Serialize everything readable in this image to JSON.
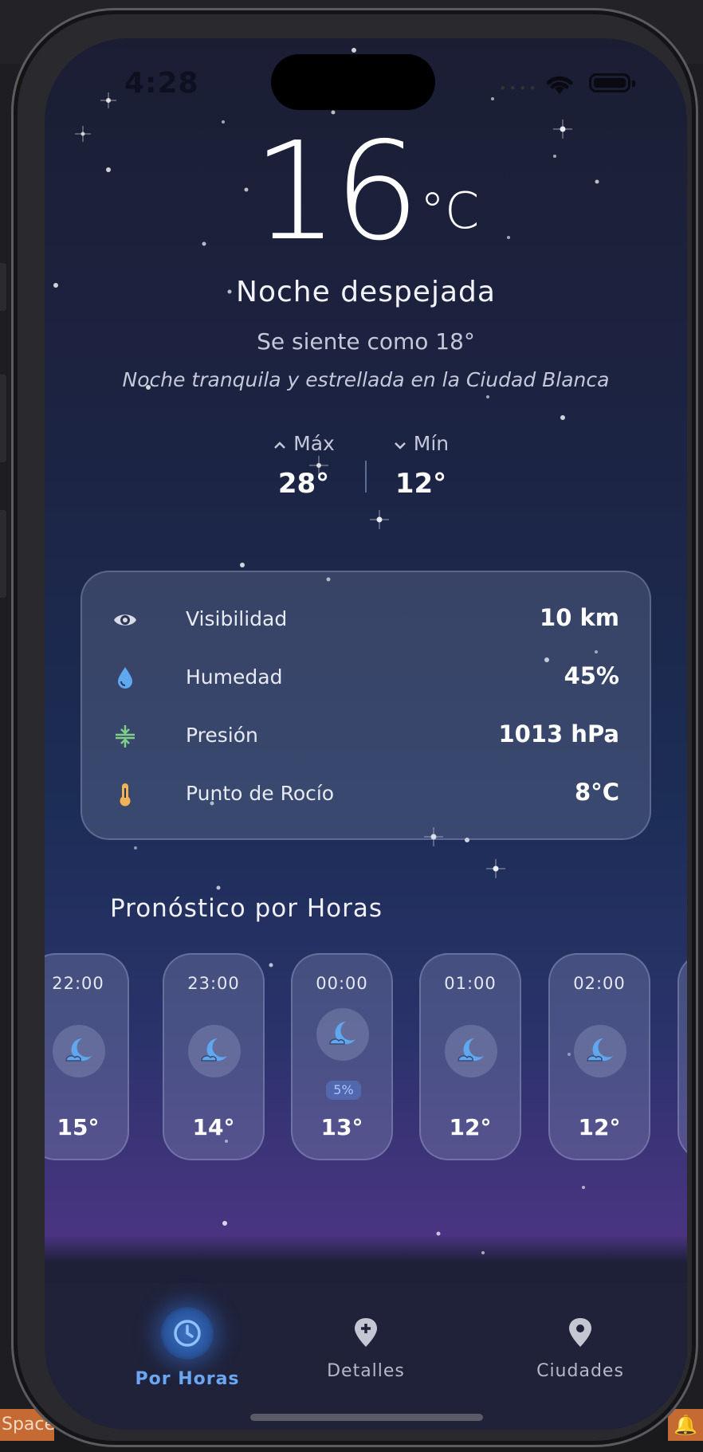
{
  "desktop": {
    "spaces_label": "Spaces",
    "bell_icon": "bell-icon"
  },
  "status_bar": {
    "time": "4:28",
    "icons": [
      "wifi-icon",
      "battery-icon"
    ]
  },
  "current": {
    "temperature": "16",
    "unit": "°C",
    "condition": "Noche despejada",
    "feels_like": "Se siente como 18°",
    "description": "Noche tranquila y estrellada en la Ciudad Blanca",
    "max_label": "Máx",
    "max_value": "28°",
    "min_label": "Mín",
    "min_value": "12°"
  },
  "details": [
    {
      "icon": "eye-icon",
      "label": "Visibilidad",
      "value": "10 km",
      "color": "#d9dbe6"
    },
    {
      "icon": "water-drop-icon",
      "label": "Humedad",
      "value": "45%",
      "color": "#5fa8f0"
    },
    {
      "icon": "pressure-icon",
      "label": "Presión",
      "value": "1013 hPa",
      "color": "#7ecf88"
    },
    {
      "icon": "thermometer-icon",
      "label": "Punto de Rocío",
      "value": "8°C",
      "color": "#f2b354"
    }
  ],
  "hourly": {
    "title": "Pronóstico por Horas",
    "items": [
      {
        "time": "22:00",
        "icon": "moon-cloud-icon",
        "temp": "15°"
      },
      {
        "time": "23:00",
        "icon": "moon-cloud-icon",
        "temp": "14°"
      },
      {
        "time": "00:00",
        "icon": "moon-cloud-icon",
        "temp": "13°",
        "precip": "5%"
      },
      {
        "time": "01:00",
        "icon": "moon-cloud-icon",
        "temp": "12°"
      },
      {
        "time": "02:00",
        "icon": "moon-cloud-icon",
        "temp": "12°"
      }
    ]
  },
  "nav": {
    "items": [
      {
        "label": "Por Horas",
        "icon": "clock-icon",
        "active": true
      },
      {
        "label": "Detalles",
        "icon": "location-plus-icon",
        "active": false
      },
      {
        "label": "Ciudades",
        "icon": "location-pin-icon",
        "active": false
      }
    ]
  },
  "colors": {
    "accent": "#6aa6f2",
    "icon_blue": "#5fa8f0"
  }
}
